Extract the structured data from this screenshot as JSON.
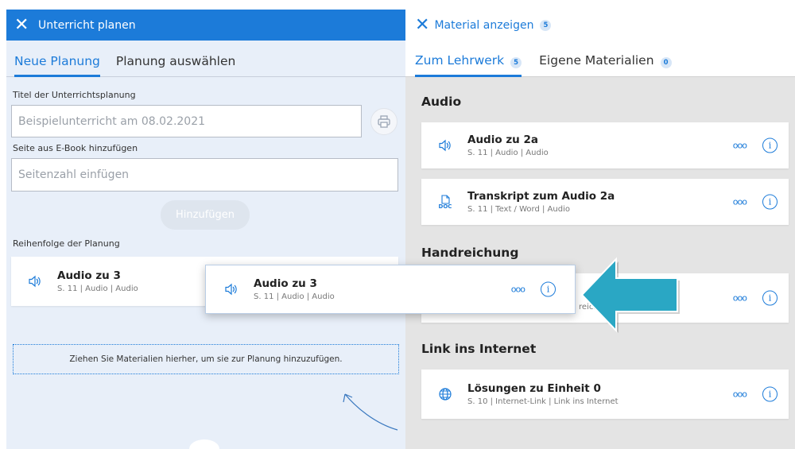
{
  "left": {
    "header_title": "Unterricht planen",
    "tabs": [
      {
        "label": "Neue Planung"
      },
      {
        "label": "Planung auswählen"
      }
    ],
    "title_label": "Titel der Unterrichtsplanung",
    "title_value": "Beispielunterricht am 08.02.2021",
    "page_label": "Seite aus E-Book hinzufügen",
    "page_placeholder": "Seitenzahl einfügen",
    "add_button": "Hinzufügen",
    "order_label": "Reihenfolge der Planung",
    "plan_item": {
      "title": "Audio zu 3",
      "meta": "S. 11 | Audio | Audio"
    },
    "drop_hint": "Ziehen Sie Materialien hierher, um sie zur Planung hinzuzufügen."
  },
  "right": {
    "header_title": "Material anzeigen",
    "header_count": "5",
    "tabs": [
      {
        "label": "Zum Lehrwerk",
        "count": "5"
      },
      {
        "label": "Eigene Materialien",
        "count": "0"
      }
    ],
    "sections": [
      {
        "title": "Audio",
        "items": [
          {
            "title": "Audio zu 2a",
            "meta": "S. 11 | Audio | Audio",
            "icon": "speaker-icon"
          },
          {
            "title": "Transkript zum Audio 2a",
            "meta": "S. 11 | Text / Word | Audio",
            "icon": "doc-icon",
            "icon_text": "DOC"
          }
        ]
      },
      {
        "title": "Handreichung",
        "items": [
          {
            "visible_fragment": "reichun"
          }
        ]
      },
      {
        "title": "Link ins Internet",
        "items": [
          {
            "title": "Lösungen zu Einheit 0",
            "meta": "S. 10 | Internet-Link | Link ins Internet",
            "icon": "globe-icon"
          }
        ]
      }
    ]
  },
  "drag_item": {
    "title": "Audio zu 3",
    "meta": "S. 11 | Audio | Audio"
  },
  "icons": {
    "more": "ooo",
    "info": "i",
    "close": "✕"
  },
  "colors": {
    "accent": "#1c7bd9",
    "arrow": "#2aa7c4",
    "left_bg": "#e8eff9",
    "right_bg": "#e4e4e4"
  }
}
